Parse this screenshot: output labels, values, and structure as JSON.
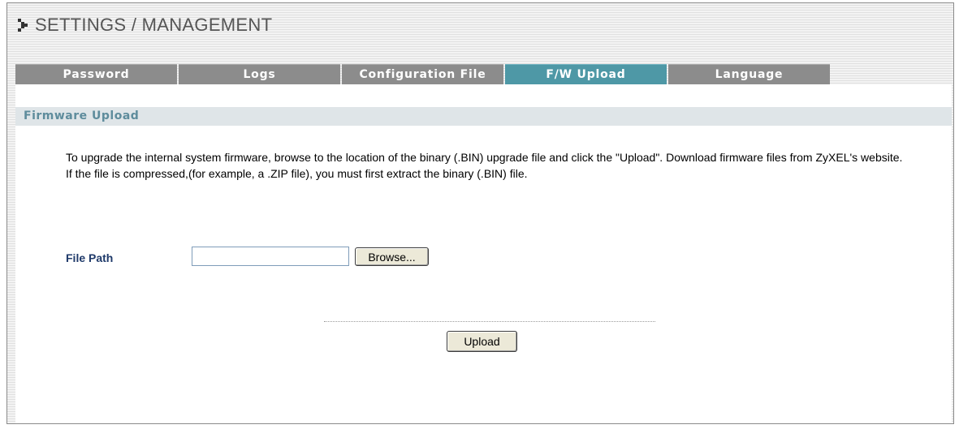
{
  "header": {
    "title": "SETTINGS / MANAGEMENT",
    "icon": "arrow-right-icon"
  },
  "tabs": [
    {
      "label": "Password",
      "active": false
    },
    {
      "label": "Logs",
      "active": false
    },
    {
      "label": "Configuration File",
      "active": false
    },
    {
      "label": "F/W Upload",
      "active": true
    },
    {
      "label": "Language",
      "active": false
    }
  ],
  "section": {
    "title": "Firmware Upload"
  },
  "description": "To upgrade the internal system firmware, browse to the location of the binary (.BIN) upgrade file and click the \"Upload\". Download firmware files from ZyXEL's website. If the file is compressed,(for example, a .ZIP file), you must first extract the binary (.BIN) file.",
  "form": {
    "file_path_label": "File Path",
    "file_path_value": "",
    "browse_label": "Browse...",
    "upload_label": "Upload"
  },
  "colors": {
    "tab_inactive": "#8c8c8c",
    "tab_active": "#4e98a6",
    "section_bar": "#dfe5e8",
    "section_title": "#5e8c9c",
    "label_blue": "#1f3a6a"
  }
}
